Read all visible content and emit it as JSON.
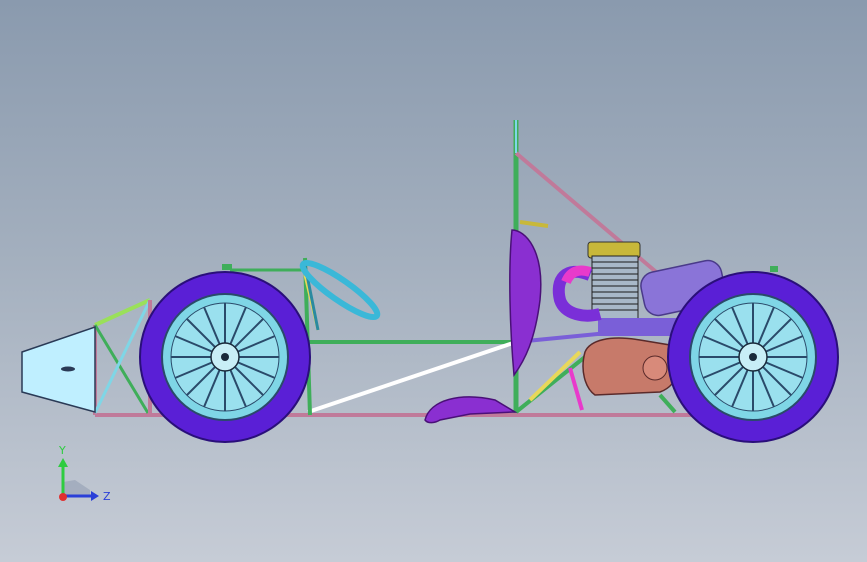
{
  "viewport": {
    "background_top": "#8a9aae",
    "background_bottom": "#c6ccd6"
  },
  "model": {
    "parts": [
      "nose-cone",
      "front-frame",
      "front-wheel",
      "steering-wheel",
      "main-hoop",
      "seat",
      "floor-pan",
      "engine",
      "exhaust",
      "air-filter",
      "gearbox",
      "rear-wheel",
      "rear-frame"
    ],
    "colors": {
      "tire": "#5a1fd6",
      "rim": "#7fd6e6",
      "nose": "#bfefff",
      "frame_green": "#3fae5a",
      "frame_pink": "#c07a9a",
      "seat": "#8a2fd1",
      "engine_block": "#a8b8c8",
      "engine_head": "#c8b83a",
      "exhaust": "#e83acb",
      "air_filter": "#8a74d8",
      "gearbox": "#c77a6a"
    }
  },
  "triad": {
    "y_label": "Y",
    "z_label": "Z",
    "y_color": "#2ecc40",
    "z_color": "#2a3fd8",
    "x_color": "#e03030"
  }
}
